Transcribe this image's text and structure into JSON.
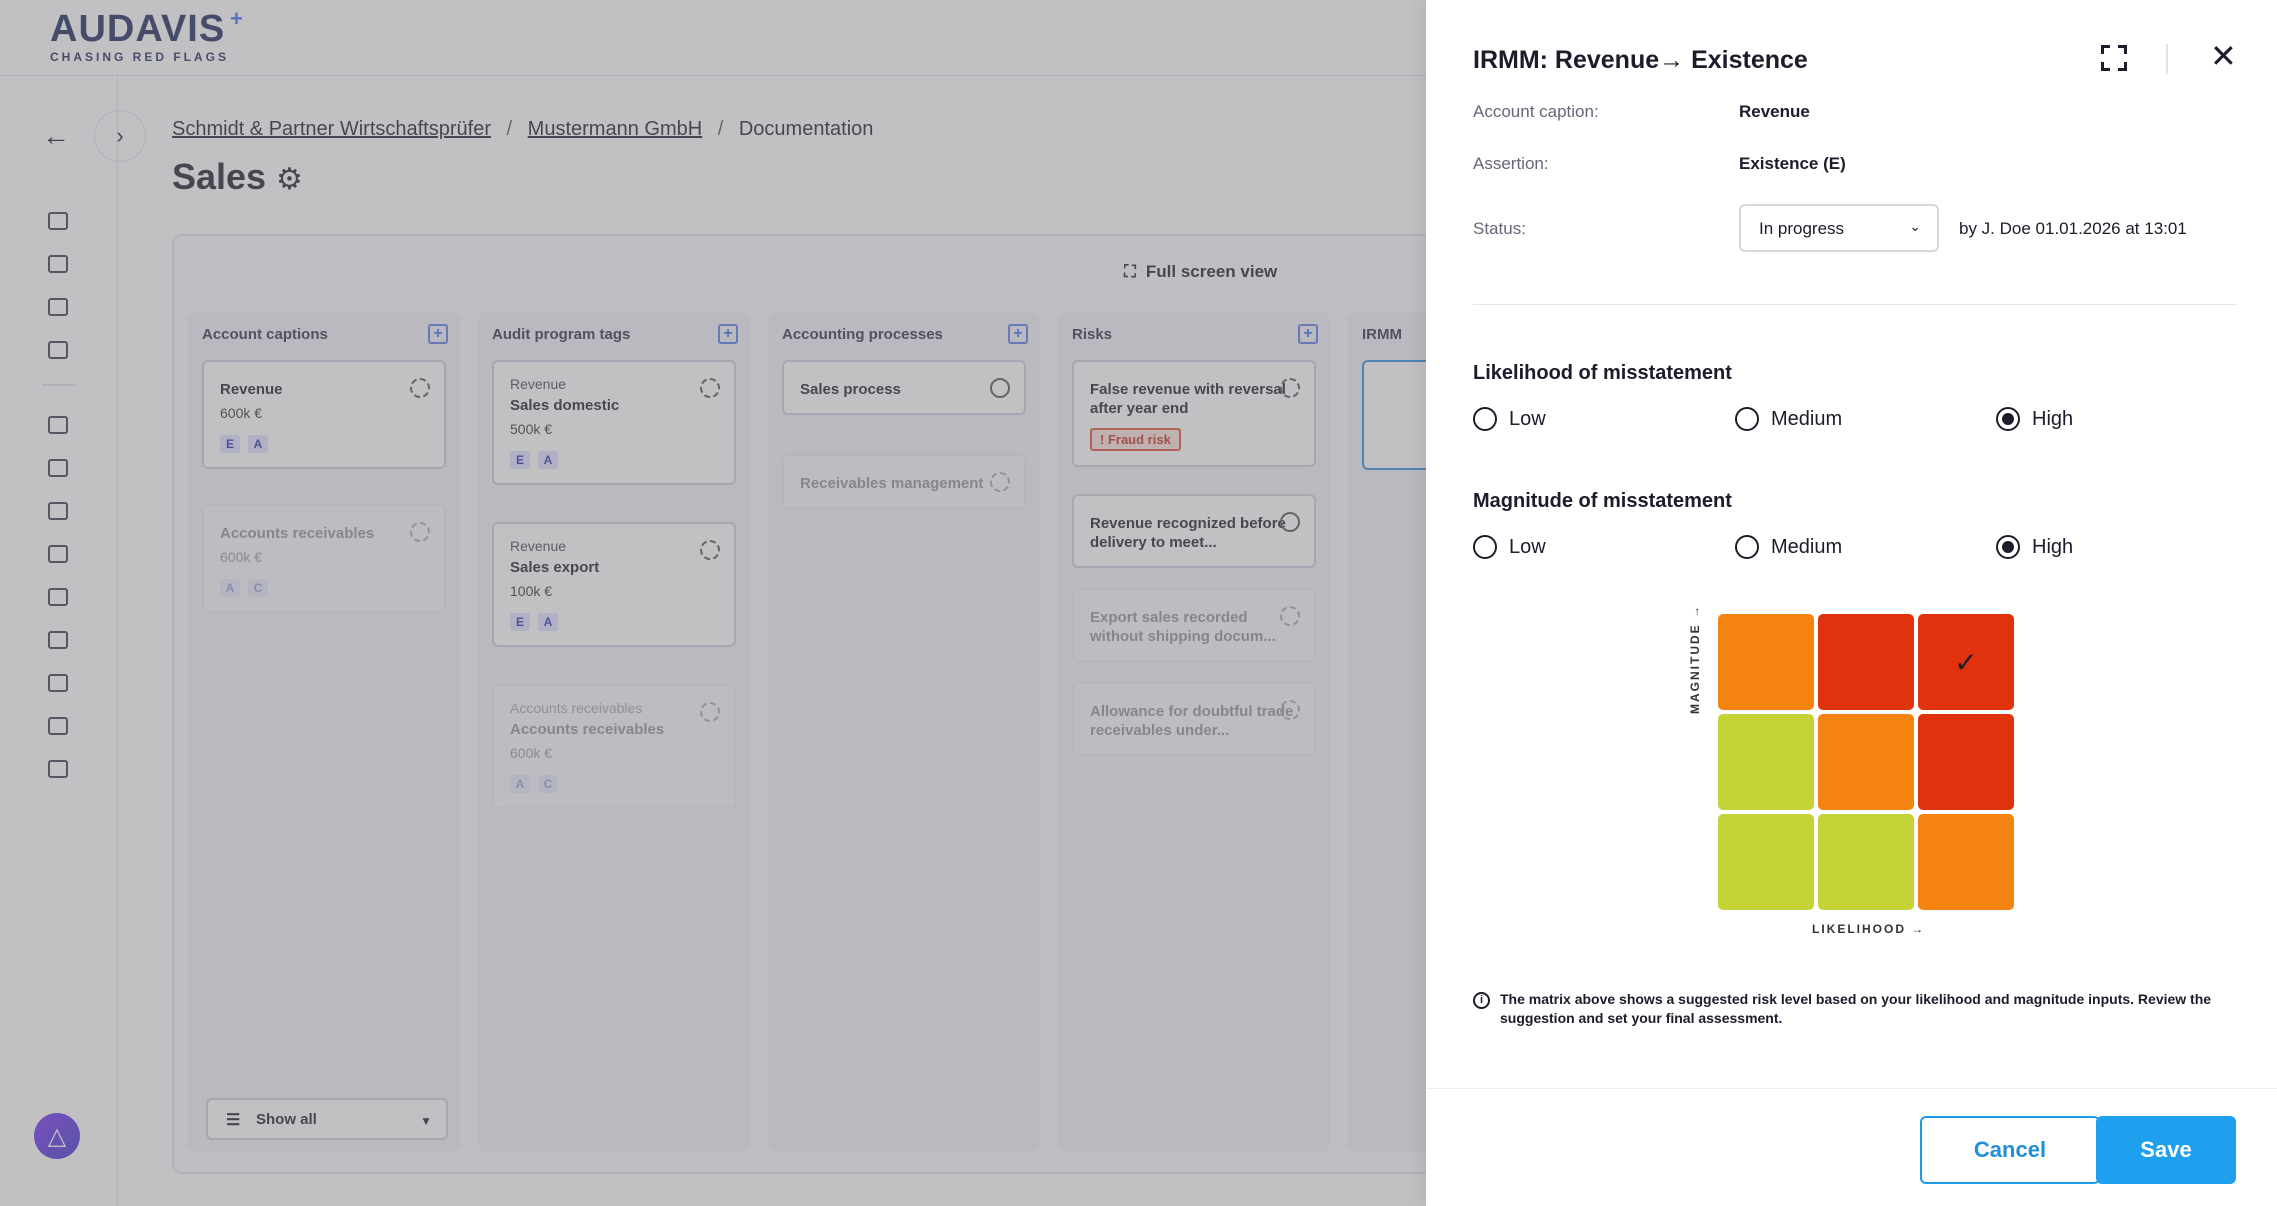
{
  "brand": {
    "name": "AUDAVIS",
    "tagline": "CHASING RED FLAGS"
  },
  "breadcrumb": {
    "items": [
      "Schmidt & Partner Wirtschaftsprüfer",
      "Mustermann GmbH",
      "Documentation"
    ],
    "separator": "/"
  },
  "page": {
    "title": "Sales"
  },
  "board": {
    "fullscreen_label": "Full screen view",
    "columns": [
      {
        "title": "Account captions"
      },
      {
        "title": "Audit program tags"
      },
      {
        "title": "Accounting processes"
      },
      {
        "title": "Risks"
      },
      {
        "title": "IRMM"
      }
    ],
    "account_captions": [
      {
        "title": "Revenue",
        "amount": "600k €",
        "tags": [
          "E",
          "A"
        ]
      },
      {
        "title": "Accounts receivables",
        "amount": "600k €",
        "tags": [
          "A",
          "C"
        ]
      }
    ],
    "audit_tags": [
      {
        "sub": "Revenue",
        "title": "Sales domestic",
        "amount": "500k €",
        "tags": [
          "E",
          "A"
        ]
      },
      {
        "sub": "Revenue",
        "title": "Sales export",
        "amount": "100k €",
        "tags": [
          "E",
          "A"
        ]
      },
      {
        "sub": "Accounts receivables",
        "title": "Accounts receivables",
        "amount": "600k €",
        "tags": [
          "A",
          "C"
        ]
      }
    ],
    "processes": [
      {
        "title": "Sales process"
      },
      {
        "title": "Receivables management"
      }
    ],
    "risks": [
      {
        "title": "False revenue with reversal after year end",
        "badge": "! Fraud risk"
      },
      {
        "title": "Revenue recognized before delivery to meet..."
      },
      {
        "title": "Export sales recorded without shipping docum..."
      },
      {
        "title": "Allowance for doubtful trade receivables under..."
      }
    ],
    "show_all_label": "Show all"
  },
  "panel": {
    "title": "IRMM: Revenue→ Existence",
    "fields": {
      "account_caption_label": "Account caption:",
      "account_caption_value": "Revenue",
      "assertion_label": "Assertion:",
      "assertion_value": "Existence (E)",
      "status_label": "Status:",
      "status_value": "In progress",
      "status_meta": "by J. Doe 01.01.2026 at 13:01"
    },
    "likelihood": {
      "title": "Likelihood of misstatement",
      "options": [
        "Low",
        "Medium",
        "High"
      ],
      "selected": "High"
    },
    "magnitude": {
      "title": "Magnitude of misstatement",
      "options": [
        "Low",
        "Medium",
        "High"
      ],
      "selected": "High"
    },
    "matrix": {
      "x_label": "LIKELIHOOD →",
      "y_label": "MAGNITUDE →",
      "selected_mark": "✓",
      "colors": {
        "low": "#c3d234",
        "medium": "#f58310",
        "high": "#e0330d"
      }
    },
    "info_text": "The matrix above shows a suggested risk level based on your likelihood and magnitude inputs. Review the suggestion and set your final assessment.",
    "buttons": {
      "cancel": "Cancel",
      "save": "Save"
    }
  }
}
